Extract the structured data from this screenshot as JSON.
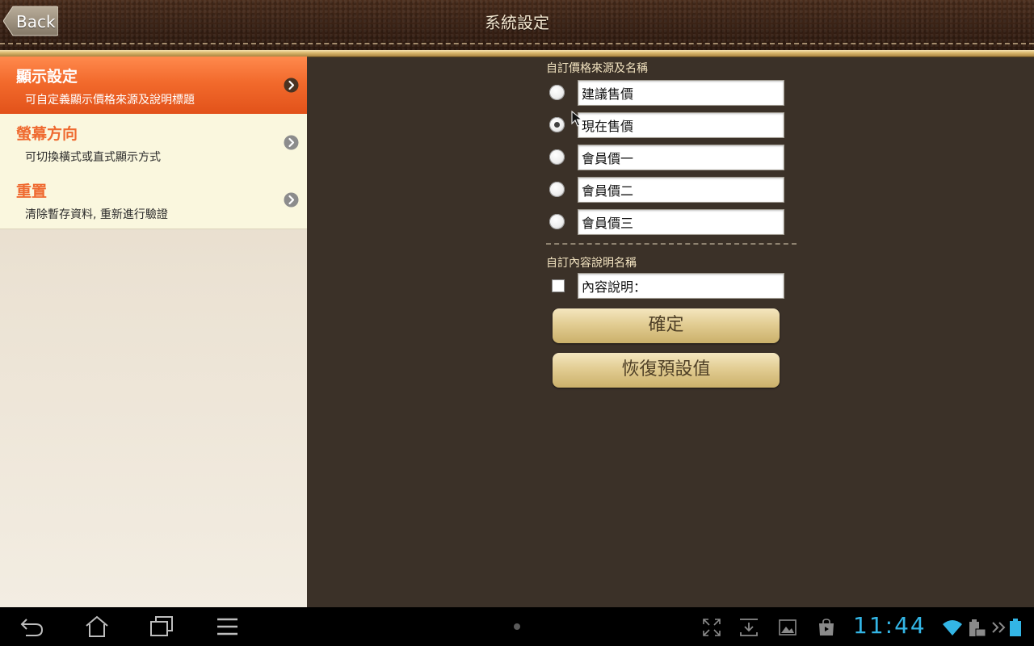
{
  "header": {
    "back_label": "Back",
    "title": "系統設定"
  },
  "sidebar": {
    "items": [
      {
        "title": "顯示設定",
        "subtitle": "可自定義顯示價格來源及說明標題",
        "active": true
      },
      {
        "title": "螢幕方向",
        "subtitle": "可切換橫式或直式顯示方式",
        "active": false
      },
      {
        "title": "重置",
        "subtitle": "清除暫存資料, 重新進行驗證",
        "active": false
      }
    ]
  },
  "main": {
    "price_section_label": "自訂價格來源及名稱",
    "price_options": [
      {
        "value": "建議售價",
        "selected": false
      },
      {
        "value": "現在售價",
        "selected": true
      },
      {
        "value": "會員價一",
        "selected": false
      },
      {
        "value": "會員價二",
        "selected": false
      },
      {
        "value": "會員價三",
        "selected": false
      }
    ],
    "desc_section_label": "自訂內容說明名稱",
    "desc_field_value": "內容說明：",
    "desc_checked": false,
    "confirm_label": "確定",
    "reset_label": "恢復預設值"
  },
  "system_bar": {
    "clock": "11:44",
    "icons": [
      "back-icon",
      "home-icon",
      "recent-apps-icon",
      "menu-icon",
      "fullscreen-icon",
      "download-icon",
      "gallery-icon",
      "store-icon",
      "wifi-icon",
      "keyboard-battery-icon",
      "chevron-double-icon",
      "battery-icon"
    ]
  },
  "colors": {
    "accent_orange": "#f26a2c",
    "panel_brown": "#3b3128",
    "gold": "#e2cd93",
    "clock_blue": "#33b5e5"
  }
}
